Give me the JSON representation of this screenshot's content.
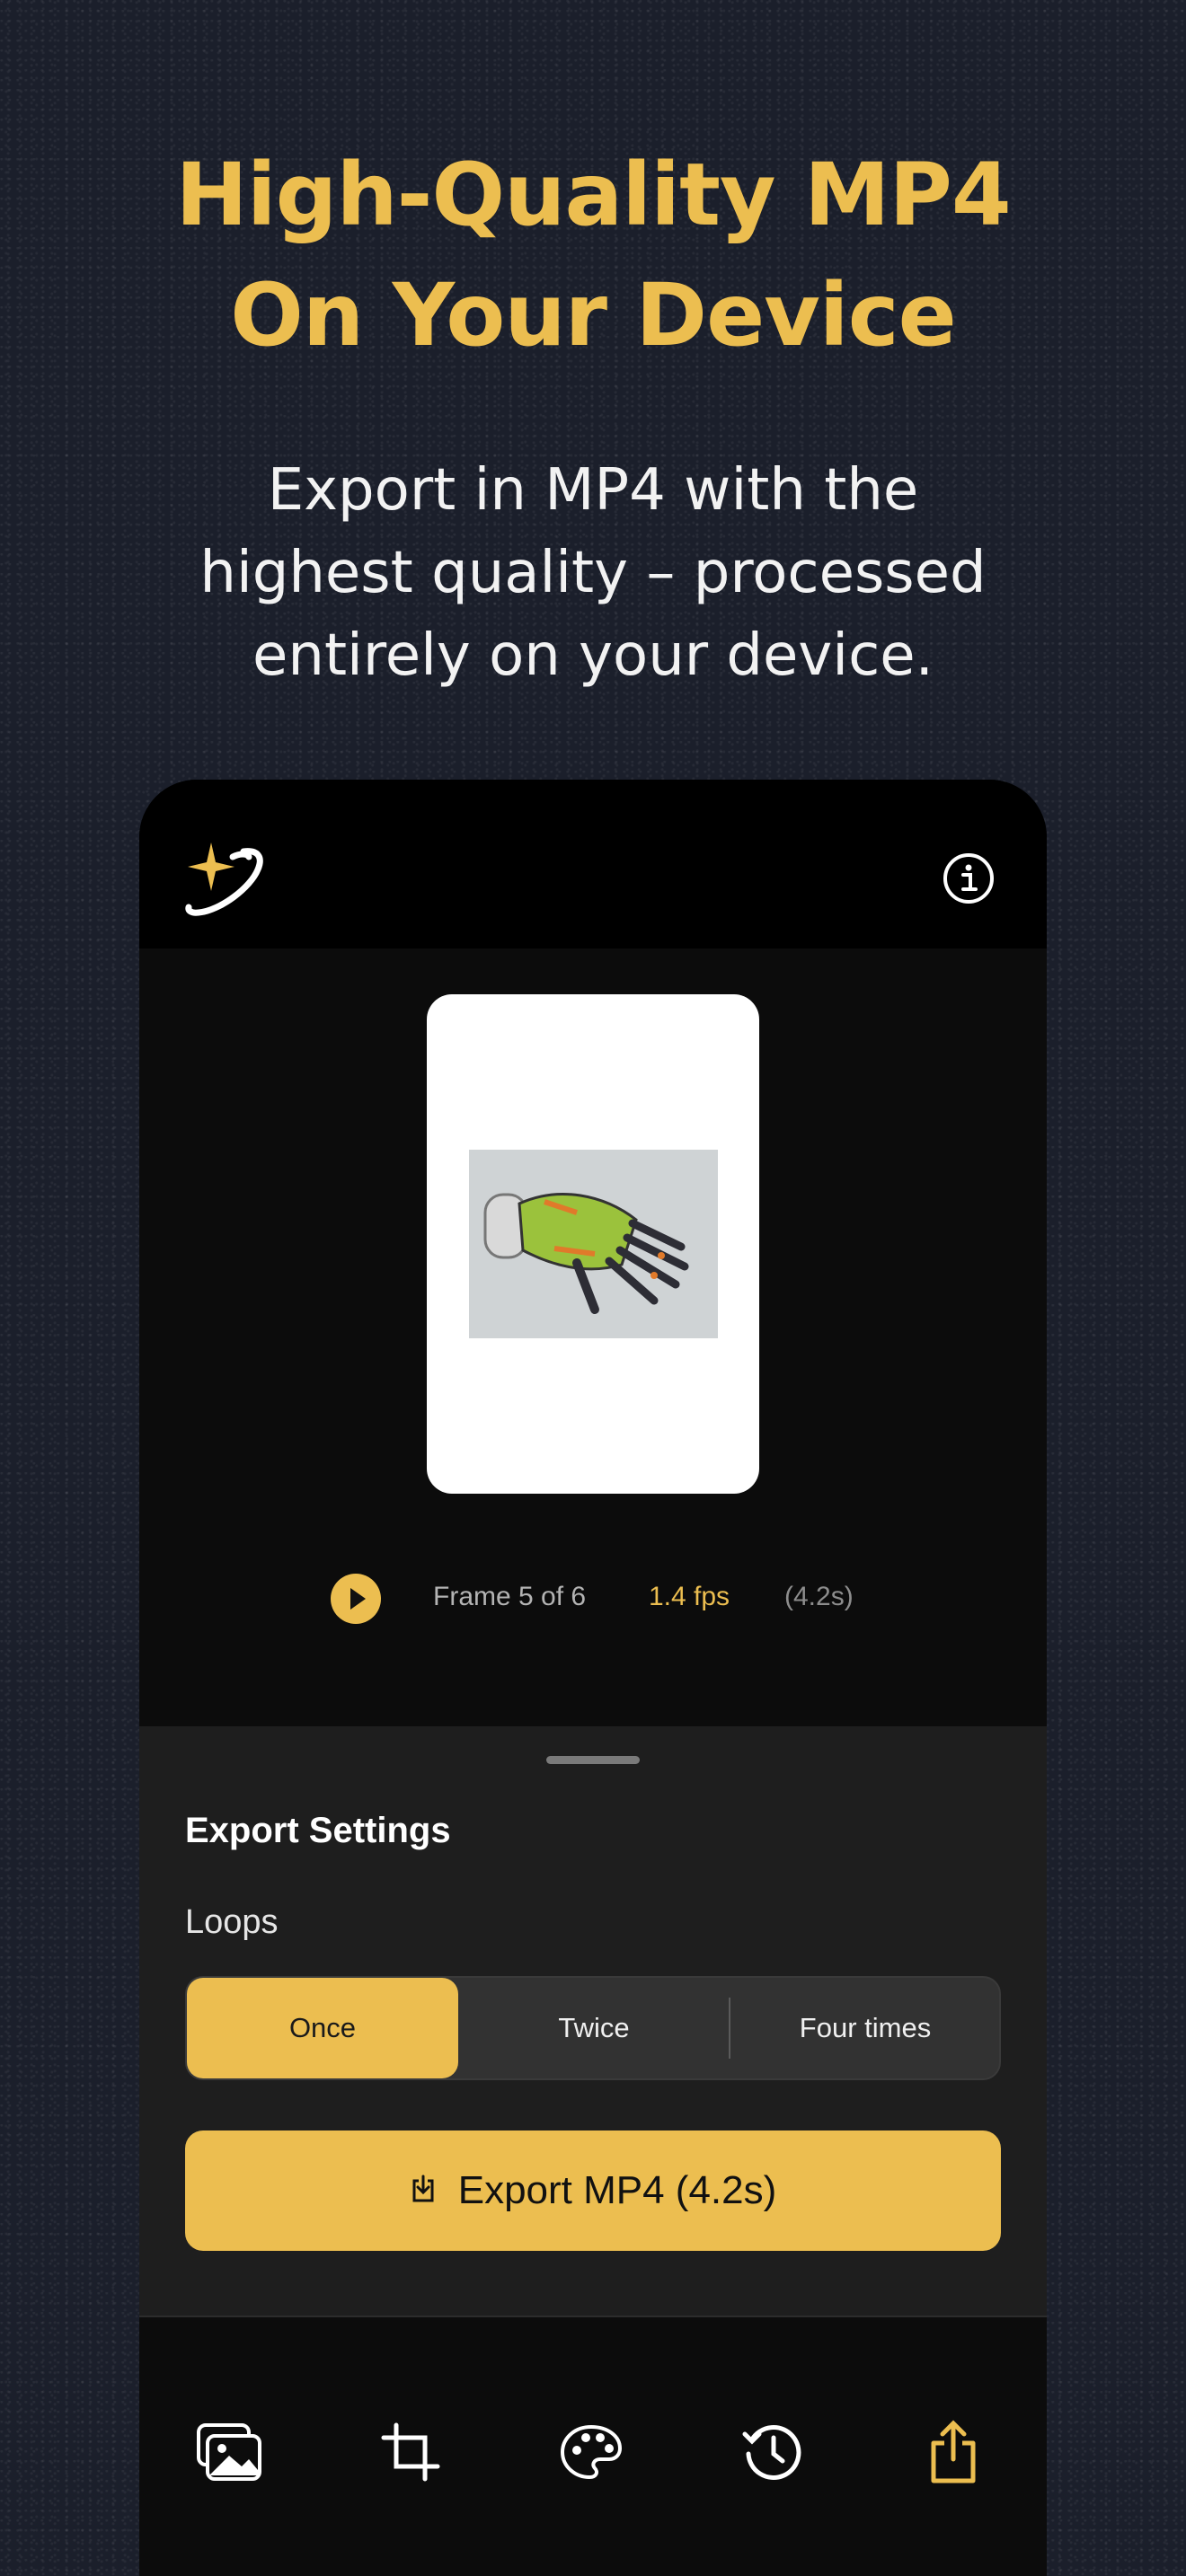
{
  "headline": {
    "line1": "High-Quality MP4",
    "line2": "On Your Device"
  },
  "subline": {
    "line1": "Export in MP4 with the",
    "line2": "highest quality – processed",
    "line3": "entirely on your device."
  },
  "colors": {
    "accent": "#ecbe50",
    "background": "#1b1f2b",
    "sheet": "#1e1e1e"
  },
  "header": {
    "logo_icon": "sparkle-orbit-icon",
    "info_icon": "info-icon"
  },
  "playback": {
    "play_icon": "play-icon",
    "frame": "Frame 5 of 6",
    "fps": "1.4 fps",
    "duration": "(4.2s)"
  },
  "export_settings": {
    "title": "Export Settings",
    "loops_label": "Loops",
    "loops_options": [
      "Once",
      "Twice",
      "Four times"
    ],
    "loops_selected": "Once",
    "export_button": "Export MP4 (4.2s)",
    "export_icon": "download-tray-icon"
  },
  "tabbar": {
    "items": [
      {
        "icon": "photos-icon",
        "active": false
      },
      {
        "icon": "crop-icon",
        "active": false
      },
      {
        "icon": "palette-icon",
        "active": false
      },
      {
        "icon": "history-icon",
        "active": false
      },
      {
        "icon": "share-icon",
        "active": true
      }
    ]
  }
}
